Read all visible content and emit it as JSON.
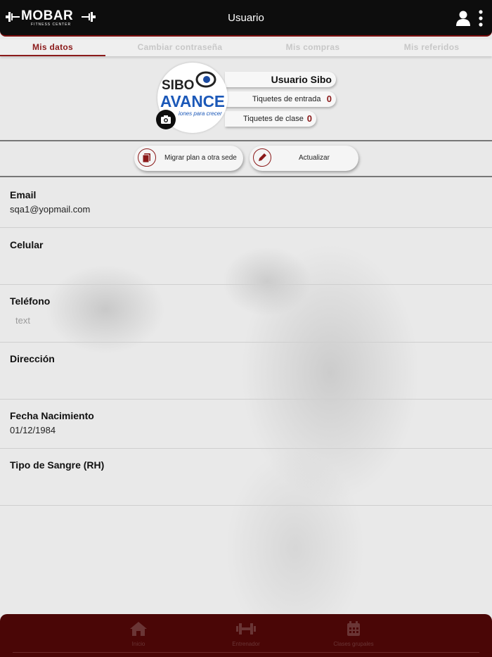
{
  "header": {
    "title": "Usuario",
    "logo": {
      "text": "MOBAR",
      "subtitle": "FITNESS CENTER"
    }
  },
  "tabs": [
    {
      "label": "Mis datos",
      "active": true
    },
    {
      "label": "Cambiar contraseña",
      "active": false
    },
    {
      "label": "Mis compras",
      "active": false
    },
    {
      "label": "Mis referidos",
      "active": false
    }
  ],
  "profile": {
    "name": "Usuario Sibo",
    "avatar_logo": {
      "line1": "SIBO",
      "line2": "AVANCE",
      "tagline": "iones para crecer"
    },
    "rows": [
      {
        "label": "Tiquetes de entrada",
        "value": "0"
      },
      {
        "label": "Tiquetes de clase",
        "value": "0"
      }
    ]
  },
  "actions": {
    "migrate_label": "Migrar plan a otra sede",
    "update_label": "Actualizar"
  },
  "fields": {
    "email": {
      "label": "Email",
      "value": "sqa1@yopmail.com"
    },
    "celular": {
      "label": "Celular",
      "value": ""
    },
    "telefono": {
      "label": "Teléfono",
      "placeholder": "text"
    },
    "direccion": {
      "label": "Dirección",
      "value": ""
    },
    "fecha": {
      "label": "Fecha Nacimiento",
      "value": "01/12/1984"
    },
    "sangre": {
      "label": "Tipo de Sangre (RH)",
      "value": ""
    }
  },
  "bottom_nav": [
    {
      "label": "Inicio",
      "icon": "home-icon"
    },
    {
      "label": "Entrenador",
      "icon": "dumbbell-icon"
    },
    {
      "label": "Clases grupales",
      "icon": "calendar-icon"
    }
  ],
  "colors": {
    "accent": "#8b1a1a",
    "header_bg": "#0d0d0d",
    "bottom_bar": "#4a0606"
  }
}
